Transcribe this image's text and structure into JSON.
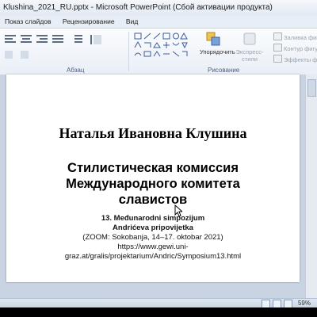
{
  "window": {
    "title": "Klushina_2021_RU.pptx - Microsoft PowerPoint (Сбой активации продукта)"
  },
  "ribbon_tabs": [
    "Показ слайдов",
    "Рецензирование",
    "Вид"
  ],
  "ribbon": {
    "paragraph_group": "Абзац",
    "drawing_group": "Рисование",
    "arrange_label": "Упорядочить",
    "quick_styles_label": "Экспресс-стили",
    "shape_fill": "Заливка фигуры",
    "shape_outline": "Контур фигуры",
    "shape_effects": "Эффекты фигур"
  },
  "slide": {
    "author": "Наталья Ивановна Клушина",
    "title_lines": [
      "Стилистическая комиссия",
      "Международного комитета",
      "славистов"
    ],
    "symposium_line1": "13. Međunarodni simpozijum",
    "symposium_line2": "Andrićeva pripovijetka",
    "symposium_line3": "(ZOOM: Sokobanja, 14–17. oktobar 2021)",
    "symposium_line4": "https://www.gewi.uni-",
    "symposium_line5": "graz.at/gralis/projektarium/Andric/Symposium13.html"
  },
  "status": {
    "zoom": "59%"
  },
  "icons": [
    "shapes-gallery-icon",
    "arrange-icon",
    "quick-styles-icon",
    "shape-fill-icon",
    "shape-outline-icon",
    "shape-effects-icon",
    "mouse-cursor-icon"
  ]
}
